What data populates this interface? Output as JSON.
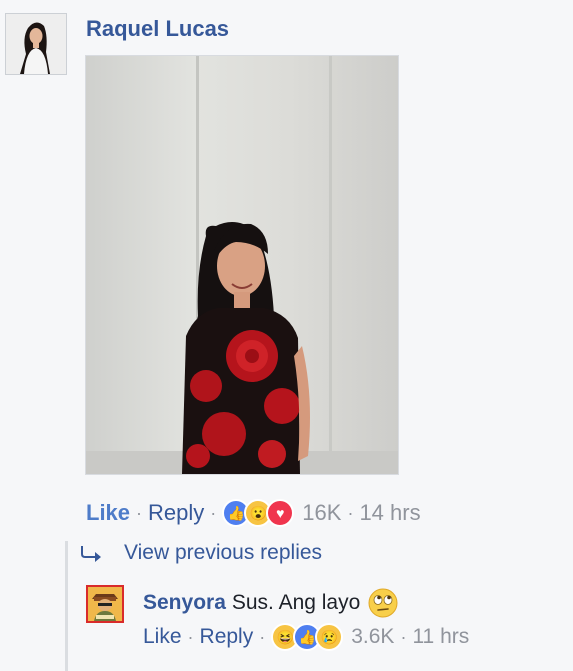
{
  "comment": {
    "author": "Raquel Lucas",
    "actions": {
      "like": "Like",
      "reply": "Reply",
      "separator": "·",
      "reaction_icons": [
        "like-reaction",
        "wow-reaction",
        "love-reaction"
      ],
      "reaction_count": "16K",
      "timestamp": "14 hrs"
    }
  },
  "replies": {
    "view_previous": "View previous replies",
    "items": [
      {
        "author": "Senyora",
        "text": "Sus. Ang layo",
        "emoji": "face-with-rolling-eyes",
        "actions": {
          "like": "Like",
          "reply": "Reply",
          "separator": "·",
          "reaction_icons": [
            "haha-reaction",
            "like-reaction",
            "sad-reaction"
          ],
          "reaction_count": "3.6K",
          "timestamp": "11 hrs"
        }
      }
    ]
  },
  "colors": {
    "link": "#365899",
    "like_bold": "#4e7cc9",
    "meta": "#90949c",
    "text": "#1d2129",
    "background": "#f6f7f9"
  }
}
